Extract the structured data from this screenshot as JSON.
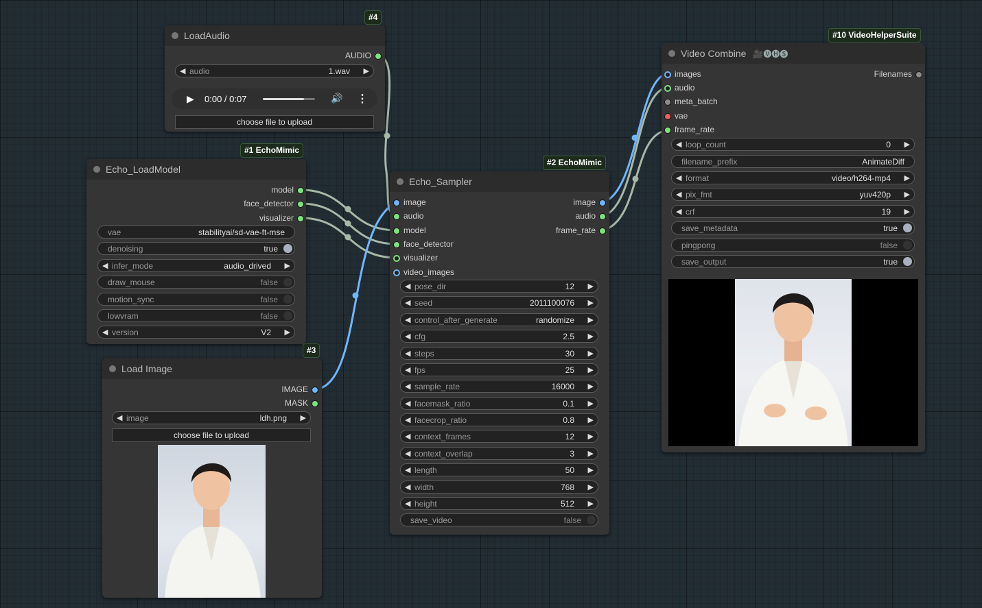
{
  "nodes": {
    "load_audio": {
      "badge": "#4",
      "title": "LoadAudio",
      "outputs": [
        "AUDIO"
      ],
      "widget": {
        "label": "audio",
        "value": "1.wav"
      },
      "player": {
        "time": "0:00 / 0:07"
      },
      "upload_label": "choose file to upload"
    },
    "echo_load_model": {
      "badge": "#1 EchoMimic",
      "title": "Echo_LoadModel",
      "outputs": [
        "model",
        "face_detector",
        "visualizer"
      ],
      "widgets": [
        {
          "label": "vae",
          "value": "stabilityai/sd-vae-ft-mse"
        },
        {
          "label": "denoising",
          "value": "true"
        },
        {
          "label": "infer_mode",
          "value": "audio_drived"
        },
        {
          "label": "draw_mouse",
          "value": "false"
        },
        {
          "label": "motion_sync",
          "value": "false"
        },
        {
          "label": "lowvram",
          "value": "false"
        },
        {
          "label": "version",
          "value": "V2"
        }
      ]
    },
    "load_image": {
      "badge": "#3",
      "title": "Load Image",
      "outputs": [
        "IMAGE",
        "MASK"
      ],
      "widget": {
        "label": "image",
        "value": "ldh.png"
      },
      "upload_label": "choose file to upload"
    },
    "echo_sampler": {
      "badge": "#2 EchoMimic",
      "title": "Echo_Sampler",
      "inputs": [
        "image",
        "audio",
        "model",
        "face_detector",
        "visualizer",
        "video_images"
      ],
      "outputs": [
        "image",
        "audio",
        "frame_rate"
      ],
      "widgets": [
        {
          "label": "pose_dir",
          "value": "12"
        },
        {
          "label": "seed",
          "value": "2011100076"
        },
        {
          "label": "control_after_generate",
          "value": "randomize"
        },
        {
          "label": "cfg",
          "value": "2.5"
        },
        {
          "label": "steps",
          "value": "30"
        },
        {
          "label": "fps",
          "value": "25"
        },
        {
          "label": "sample_rate",
          "value": "16000"
        },
        {
          "label": "facemask_ratio",
          "value": "0.1"
        },
        {
          "label": "facecrop_ratio",
          "value": "0.8"
        },
        {
          "label": "context_frames",
          "value": "12"
        },
        {
          "label": "context_overlap",
          "value": "3"
        },
        {
          "label": "length",
          "value": "50"
        },
        {
          "label": "width",
          "value": "768"
        },
        {
          "label": "height",
          "value": "512"
        },
        {
          "label": "save_video",
          "value": "false"
        }
      ]
    },
    "video_combine": {
      "badge": "#10 VideoHelperSuite",
      "title": "Video Combine",
      "title_icons": "🎥🅥🅗🅢",
      "inputs": [
        "images",
        "audio",
        "meta_batch",
        "vae",
        "frame_rate"
      ],
      "outputs": [
        "Filenames"
      ],
      "widgets": [
        {
          "label": "loop_count",
          "value": "0"
        },
        {
          "label": "filename_prefix",
          "value": "AnimateDiff"
        },
        {
          "label": "format",
          "value": "video/h264-mp4"
        },
        {
          "label": "pix_fmt",
          "value": "yuv420p"
        },
        {
          "label": "crf",
          "value": "19"
        },
        {
          "label": "save_metadata",
          "value": "true"
        },
        {
          "label": "pingpong",
          "value": "false"
        },
        {
          "label": "save_output",
          "value": "true"
        }
      ]
    }
  },
  "colors": {
    "background": "#222c33",
    "node": "#353535",
    "link_image": "#6fb6ff",
    "link_generic": "#a6b8a6",
    "slot_green": "#7ee37e",
    "slot_red": "#f15d5d"
  }
}
